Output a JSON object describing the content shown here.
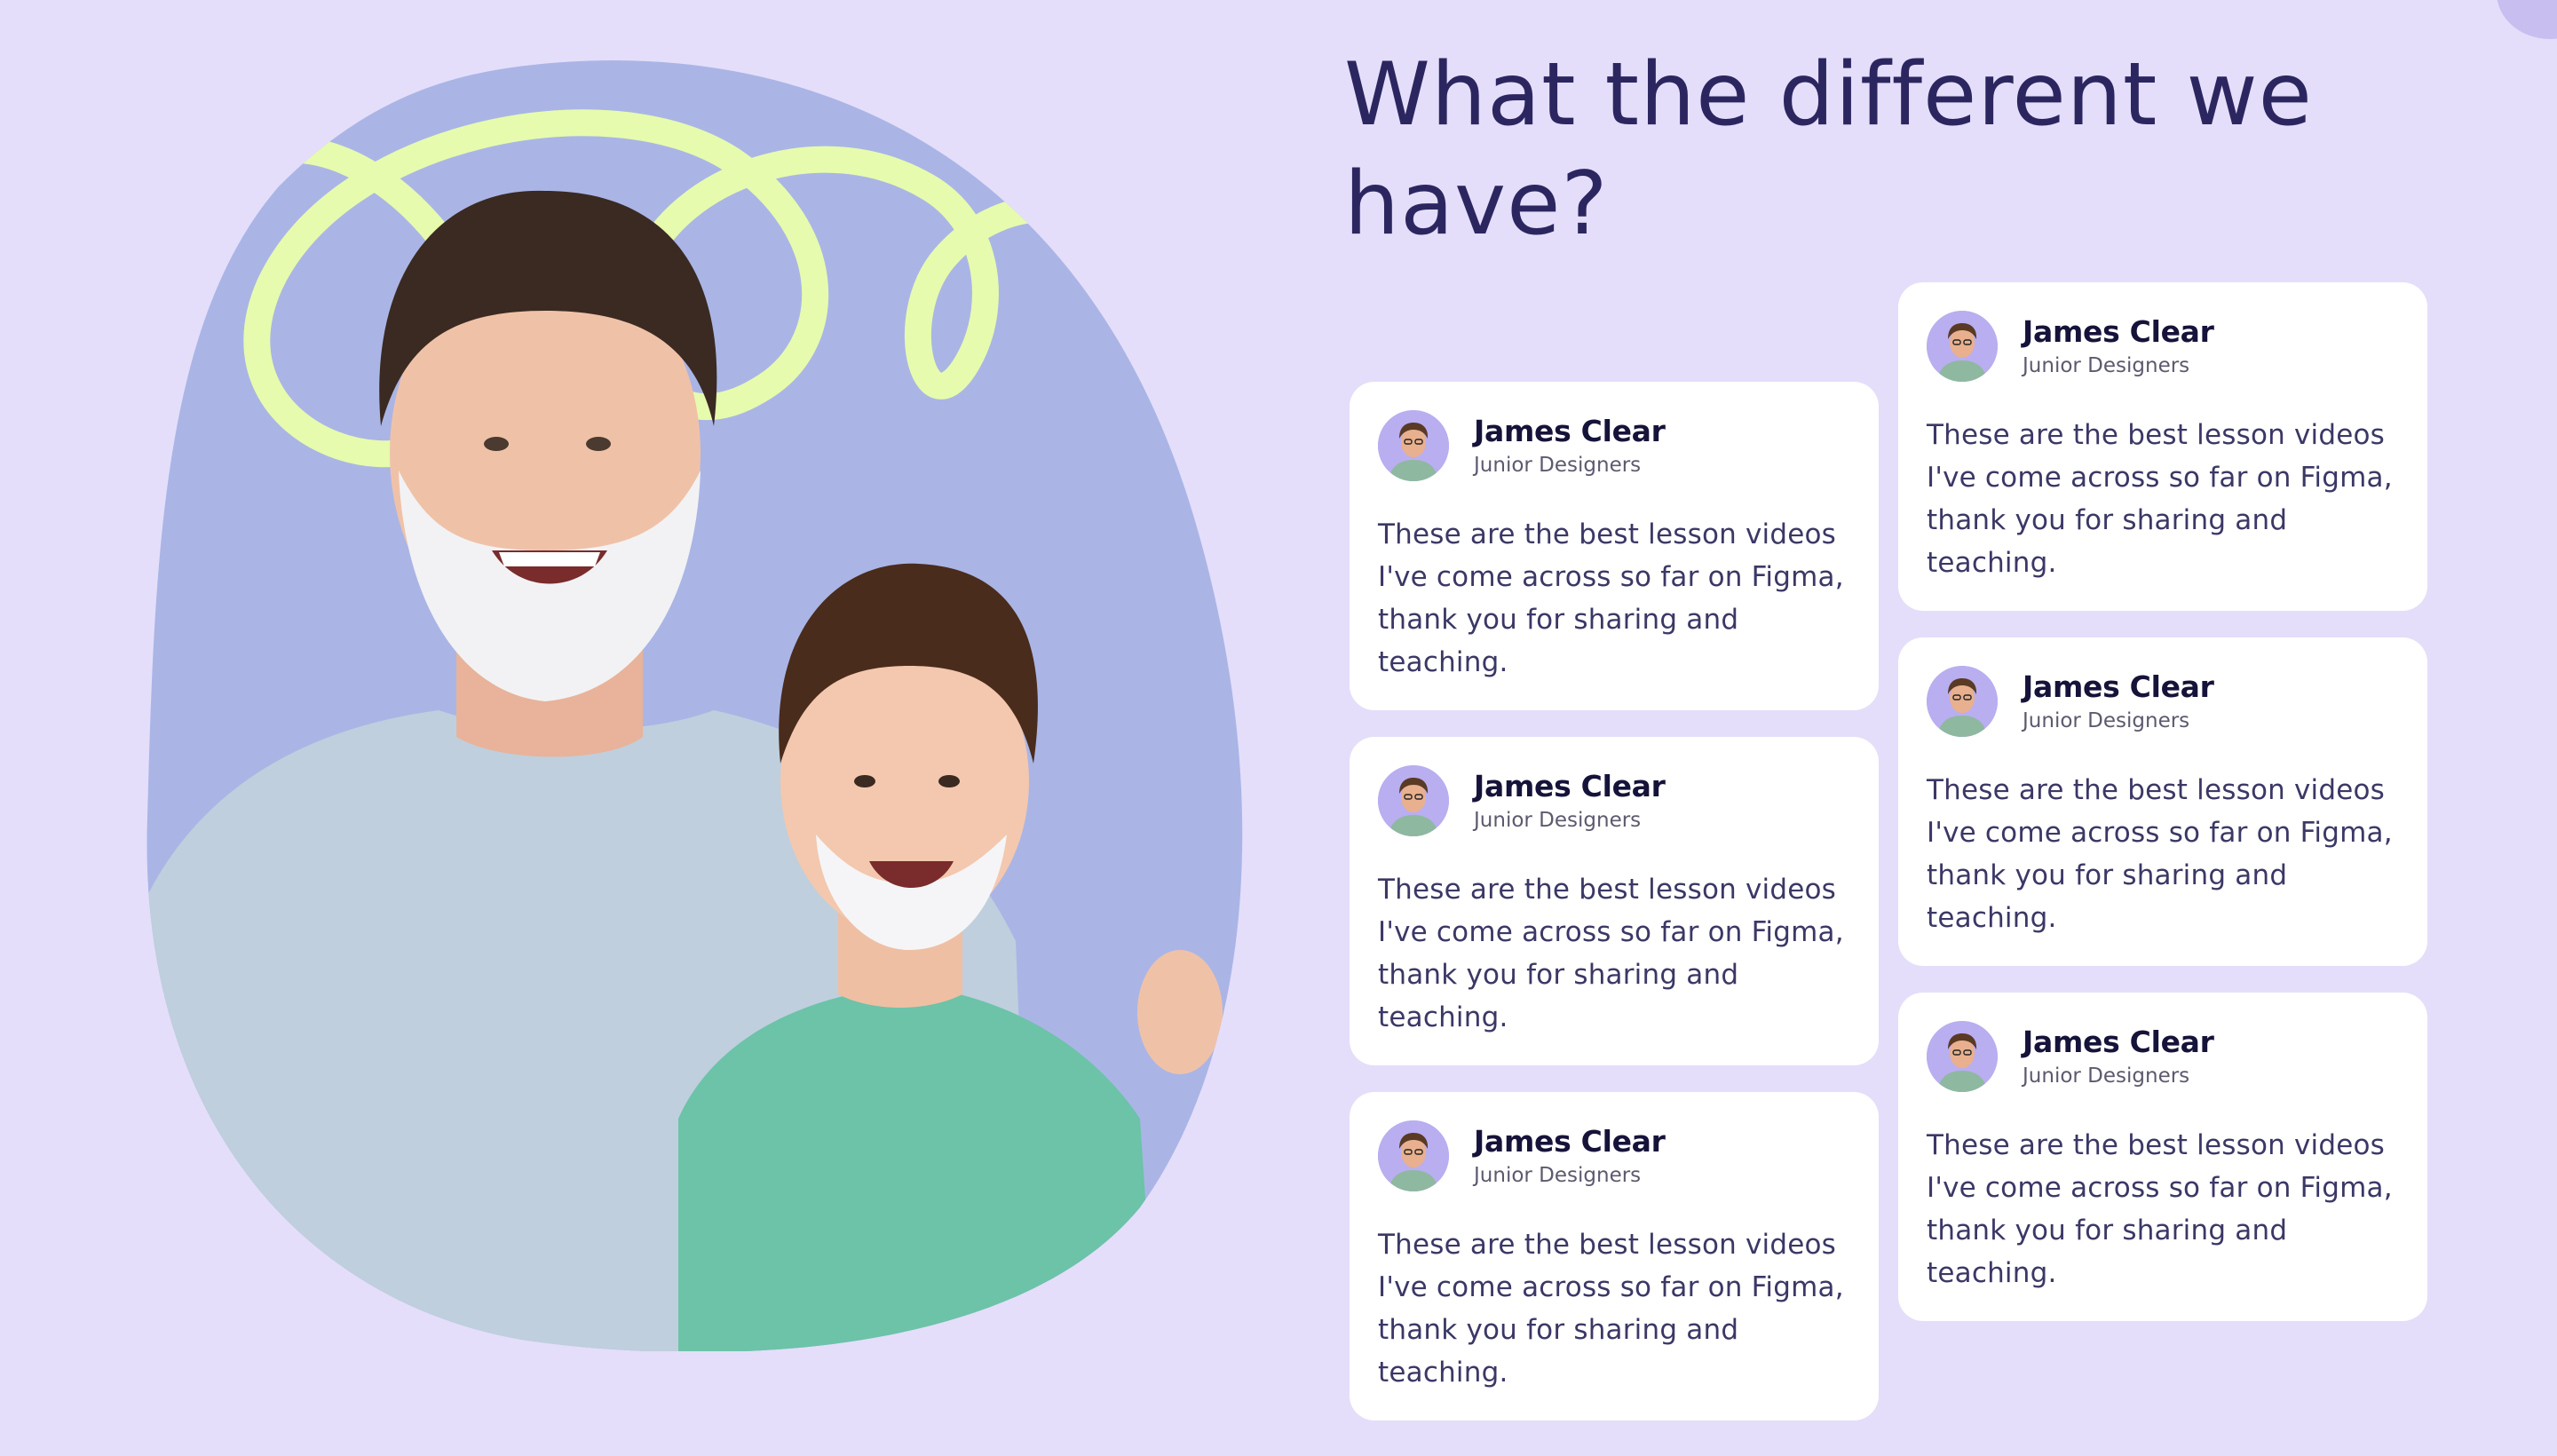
{
  "section": {
    "title": "What the different we have?"
  },
  "testimonials": [
    {
      "name": "James Clear",
      "role": "Junior Designers",
      "quote": "These are the best lesson videos I've come across so far on Figma, thank you for sharing and teaching."
    },
    {
      "name": "James Clear",
      "role": "Junior Designers",
      "quote": "These are the best lesson videos I've come across so far on Figma, thank you for sharing and teaching."
    },
    {
      "name": "James Clear",
      "role": "Junior Designers",
      "quote": "These are the best lesson videos I've come across so far on Figma, thank you for sharing and teaching."
    },
    {
      "name": "James Clear",
      "role": "Junior Designers",
      "quote": "These are the best lesson videos I've come across so far on Figma, thank you for sharing and teaching."
    },
    {
      "name": "James Clear",
      "role": "Junior Designers",
      "quote": "These are the best lesson videos I've come across so far on Figma, thank you for sharing and teaching."
    },
    {
      "name": "James Clear",
      "role": "Junior Designers",
      "quote": "These are the best lesson videos I've come across so far on Figma, thank you for sharing and teaching."
    }
  ],
  "hero_image": {
    "icon": "father-son-shaving-photo"
  },
  "colors": {
    "background": "#e4defa",
    "blob": "#aab5e6",
    "squiggle": "#e6fbad",
    "title": "#2c2660",
    "card": "#ffffff"
  }
}
